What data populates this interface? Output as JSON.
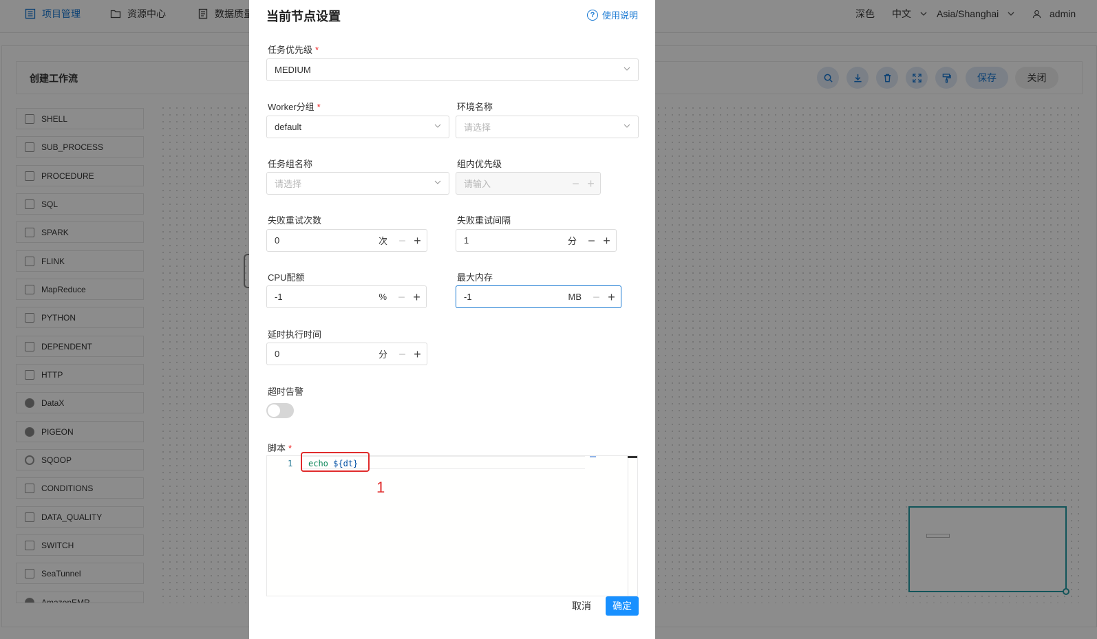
{
  "topnav": {
    "items": [
      {
        "label": "项目管理",
        "icon": "list-icon"
      },
      {
        "label": "资源中心",
        "icon": "folder-icon"
      },
      {
        "label": "数据质量",
        "icon": "document-icon"
      }
    ],
    "theme_label": "深色",
    "language_label": "中文",
    "timezone_label": "Asia/Shanghai",
    "user_label": "admin"
  },
  "workflow": {
    "title": "创建工作流",
    "toolbar": {
      "icons": [
        "search-icon",
        "download-icon",
        "delete-icon",
        "fullscreen-icon",
        "format-icon"
      ],
      "save_label": "保存",
      "close_label": "关闭"
    },
    "palette": [
      {
        "label": "SHELL",
        "icon": "shell-icon"
      },
      {
        "label": "SUB_PROCESS",
        "icon": "sub-process-icon"
      },
      {
        "label": "PROCEDURE",
        "icon": "procedure-icon"
      },
      {
        "label": "SQL",
        "icon": "sql-icon"
      },
      {
        "label": "SPARK",
        "icon": "spark-icon"
      },
      {
        "label": "FLINK",
        "icon": "flink-icon"
      },
      {
        "label": "MapReduce",
        "icon": "mapreduce-icon"
      },
      {
        "label": "PYTHON",
        "icon": "python-icon"
      },
      {
        "label": "DEPENDENT",
        "icon": "dependent-icon"
      },
      {
        "label": "HTTP",
        "icon": "http-icon"
      },
      {
        "label": "DataX",
        "icon": "datax-icon"
      },
      {
        "label": "PIGEON",
        "icon": "pigeon-icon"
      },
      {
        "label": "SQOOP",
        "icon": "sqoop-icon"
      },
      {
        "label": "CONDITIONS",
        "icon": "conditions-icon"
      },
      {
        "label": "DATA_QUALITY",
        "icon": "data-quality-icon"
      },
      {
        "label": "SWITCH",
        "icon": "switch-icon"
      },
      {
        "label": "SeaTunnel",
        "icon": "seatunnel-icon"
      },
      {
        "label": "AmazonEMR",
        "icon": "amazon-emr-icon"
      }
    ]
  },
  "drawer": {
    "title": "当前节点设置",
    "help_label": "使用说明",
    "task_priority": {
      "label": "任务优先级",
      "value": "MEDIUM"
    },
    "worker_group": {
      "label": "Worker分组",
      "value": "default"
    },
    "environment": {
      "label": "环境名称",
      "placeholder": "请选择"
    },
    "task_group": {
      "label": "任务组名称",
      "placeholder": "请选择"
    },
    "group_priority": {
      "label": "组内优先级",
      "placeholder": "请输入"
    },
    "retry_times": {
      "label": "失败重试次数",
      "value": "0",
      "unit": "次"
    },
    "retry_interval": {
      "label": "失败重试间隔",
      "value": "1",
      "unit": "分"
    },
    "cpu_quota": {
      "label": "CPU配额",
      "value": "-1",
      "unit": "%"
    },
    "max_memory": {
      "label": "最大内存",
      "value": "-1",
      "unit": "MB"
    },
    "delay_time": {
      "label": "延时执行时间",
      "value": "0",
      "unit": "分"
    },
    "timeout_alarm": {
      "label": "超时告警",
      "enabled": false
    },
    "script": {
      "label": "脚本",
      "line_number": "1",
      "code_keyword": "echo",
      "code_var": "${dt}"
    },
    "annotation_label": "1",
    "cancel_label": "取消",
    "confirm_label": "确定"
  },
  "colors": {
    "primary": "#1890ff",
    "link": "#1677d2",
    "annotation": "#e02b2b",
    "minimap_border": "#1f9aa3"
  }
}
